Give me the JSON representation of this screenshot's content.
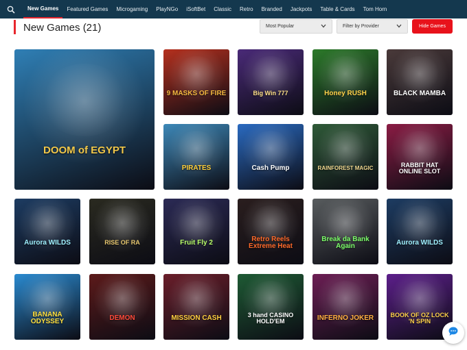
{
  "nav": {
    "items": [
      {
        "label": "New Games",
        "active": true
      },
      {
        "label": "Featured Games"
      },
      {
        "label": "Microgaming"
      },
      {
        "label": "PlayNGo"
      },
      {
        "label": "iSoftBet"
      },
      {
        "label": "Classic"
      },
      {
        "label": "Retro"
      },
      {
        "label": "Branded"
      },
      {
        "label": "Jackpots"
      },
      {
        "label": "Table & Cards"
      },
      {
        "label": "Tom Horn"
      }
    ]
  },
  "page": {
    "title": "New Games (21)"
  },
  "controls": {
    "sort_label": "Most Popular",
    "provider_label": "Filter by Provider",
    "hide_label": "Hide Games"
  },
  "games": [
    {
      "title": "DOOM of EGYPT",
      "color": "#2f7fb5"
    },
    {
      "title": "9 MASKS OF FIRE",
      "color": "#b5301e"
    },
    {
      "title": "Big Win 777",
      "color": "#4a2a78"
    },
    {
      "title": "Honey RUSH",
      "color": "#2c7a2a"
    },
    {
      "title": "BLACK MAMBA",
      "color": "#4a3a3a"
    },
    {
      "title": "PIRATES",
      "color": "#3d88b8"
    },
    {
      "title": "Cash Pump",
      "color": "#2a6ac0"
    },
    {
      "title": "RAINFOREST MAGIC",
      "color": "#2f5a38"
    },
    {
      "title": "RABBIT HAT ONLINE SLOT",
      "color": "#8a1c44"
    },
    {
      "title": "Aurora WILDS",
      "color": "#1d3c62"
    },
    {
      "title": "RISE OF RA",
      "color": "#2a2a20"
    },
    {
      "title": "Fruit Fly 2",
      "color": "#2b2a55"
    },
    {
      "title": "Retro Reels Extreme Heat",
      "color": "#2a1e1e"
    },
    {
      "title": "Break da Bank Again",
      "color": "#585c5e"
    },
    {
      "title": "Aurora WILDS",
      "color": "#1d3c62"
    },
    {
      "title": "BANANA ODYSSEY",
      "color": "#2a8ad0"
    },
    {
      "title": "DEMON",
      "color": "#5c1a1a"
    },
    {
      "title": "MISSION CASH",
      "color": "#6a1e2a"
    },
    {
      "title": "3 hand CASINO HOLD'EM",
      "color": "#1e5a34"
    },
    {
      "title": "INFERNO JOKER",
      "color": "#6c1e54"
    },
    {
      "title": "BOOK OF OZ LOCK 'N SPIN",
      "color": "#5c1f8a"
    }
  ]
}
